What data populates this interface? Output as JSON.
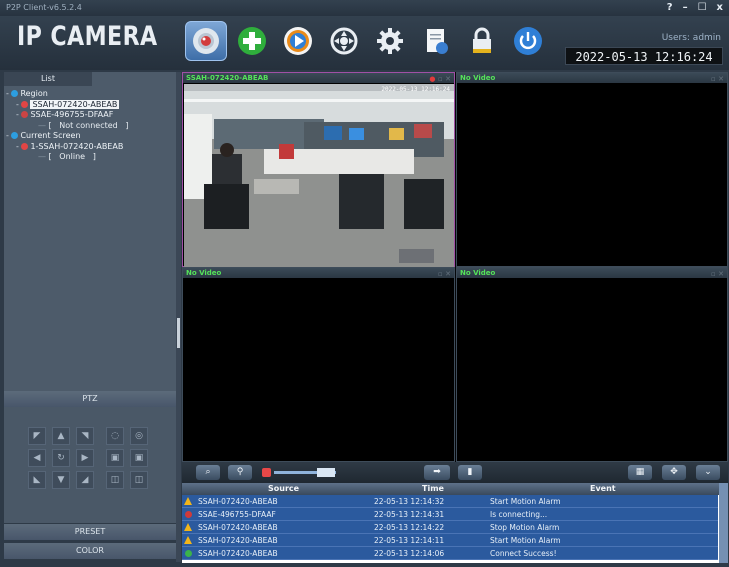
{
  "window": {
    "title": "P2P Client-v6.5.2.4",
    "controls": [
      "?",
      "–",
      "☐",
      "x"
    ]
  },
  "header": {
    "brand": "IP CAMERA",
    "users": "Users: admin",
    "datetime": "2022-05-13 12:16:24",
    "toolbar": [
      {
        "name": "live-view-camera",
        "icon": "camera-icon",
        "active": true
      },
      {
        "name": "add-device",
        "icon": "plus-icon"
      },
      {
        "name": "playback",
        "icon": "play-icon"
      },
      {
        "name": "ptz-control",
        "icon": "ptz-icon"
      },
      {
        "name": "settings",
        "icon": "gear-icon"
      },
      {
        "name": "logs",
        "icon": "document-icon"
      },
      {
        "name": "lock",
        "icon": "lock-icon"
      },
      {
        "name": "exit",
        "icon": "power-icon"
      }
    ]
  },
  "sidebar": {
    "tab": "List",
    "tree": [
      {
        "label": "Region",
        "level": 0,
        "icon": "region-globe"
      },
      {
        "label": "SSAH-072420-ABEAB",
        "level": 1,
        "icon": "camera-online",
        "selected": true
      },
      {
        "label": "SSAE-496755-DFAAF",
        "level": 1,
        "icon": "camera-offline"
      },
      {
        "label": "[   Not connected   ]",
        "level": 2
      },
      {
        "label": "Current Screen",
        "level": 0,
        "icon": "screen-globe"
      },
      {
        "label": "1-SSAH-072420-ABEAB",
        "level": 1,
        "icon": "camera-online"
      },
      {
        "label": "[   Online   ]",
        "level": 2
      }
    ]
  },
  "ptz": {
    "title": "PTZ",
    "preset": "PRESET",
    "color": "COLOR"
  },
  "video": {
    "panes": [
      {
        "title": "SSAH-072420-ABEAB",
        "overlay": "2022-05-13 12:16:24"
      },
      {
        "title": "No Video"
      },
      {
        "title": "No Video"
      },
      {
        "title": "No Video"
      }
    ]
  },
  "events": {
    "columns": [
      "Source",
      "Time",
      "Event"
    ],
    "rows": [
      {
        "type": "warn",
        "source": "SSAH-072420-ABEAB",
        "time": "22-05-13 12:14:32",
        "event": "Start Motion Alarm"
      },
      {
        "type": "info",
        "source": "SSAE-496755-DFAAF",
        "time": "22-05-13 12:14:31",
        "event": "Is connecting..."
      },
      {
        "type": "warn",
        "source": "SSAH-072420-ABEAB",
        "time": "22-05-13 12:14:22",
        "event": "Stop Motion Alarm"
      },
      {
        "type": "warn",
        "source": "SSAH-072420-ABEAB",
        "time": "22-05-13 12:14:11",
        "event": "Start Motion Alarm"
      },
      {
        "type": "ok",
        "source": "SSAH-072420-ABEAB",
        "time": "22-05-13 12:14:06",
        "event": "Connect Success!"
      }
    ]
  }
}
